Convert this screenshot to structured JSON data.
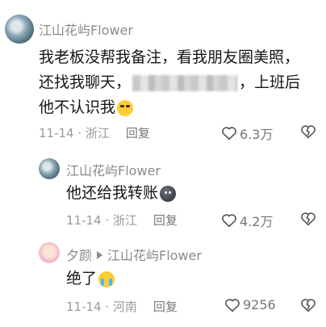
{
  "comments": [
    {
      "user": "江山花屿Flower",
      "lines": [
        "我老板没帮我备注，看我朋友圈美照，",
        "还找我聊天，",
        "，上班后",
        "他不认识我"
      ],
      "date": "11-14",
      "location": "浙江",
      "reply_label": "回复",
      "likes": "6.3万"
    },
    {
      "user": "江山花屿Flower",
      "text": "他还给我转账",
      "date": "11-14",
      "location": "浙江",
      "reply_label": "回复",
      "likes": "4.2万"
    },
    {
      "user": "夕颜",
      "reply_to": "江山花屿Flower",
      "text": "绝了",
      "date": "11-14",
      "location": "河南",
      "reply_label": "回复",
      "likes": "9256"
    }
  ],
  "icons": {
    "like": "heart-outline-icon",
    "dislike": "broken-heart-icon"
  },
  "colors": {
    "text": "#161616",
    "meta": "#9a9a9a",
    "name": "#8a8a8a"
  }
}
